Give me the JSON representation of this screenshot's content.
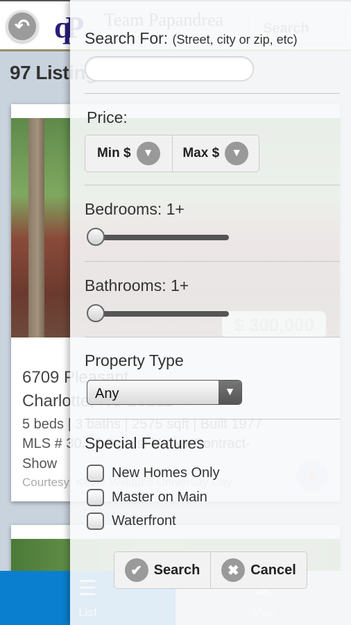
{
  "header": {
    "back_icon": "undo-arrow-icon",
    "logo_mark": "qP",
    "logo_text": "Team Papandrea",
    "search_label": "Search",
    "search_icon": "magnifier-icon"
  },
  "listing_count": "97 Listings",
  "listing": {
    "price": "$ 300,000",
    "address_line1": "6709 Pleasant",
    "address_line2": "Charlotte, NC 28211",
    "meta": "5 beds | 3 baths | 2575 sqft | Built 1977",
    "mls": "MLS # 30... | Status: Under Contract-",
    "status_cont": "Show",
    "courtesy": "Courtesy: Keller Williams University City",
    "favorite_icon": "heart-icon"
  },
  "tabs": [
    {
      "label": "List",
      "icon": "list-icon",
      "active": true
    },
    {
      "label": "Map",
      "icon": "map-icon",
      "active": false
    }
  ],
  "search_panel": {
    "search_for_label": "Search For:",
    "search_for_hint": "(Street, city or zip, etc)",
    "search_input_value": "",
    "search_input_placeholder": "",
    "price_label": "Price:",
    "min_price_label": "Min $",
    "max_price_label": "Max $",
    "bedrooms_label": "Bedrooms: 1+",
    "bedrooms_value": 1,
    "bathrooms_label": "Bathrooms: 1+",
    "bathrooms_value": 1,
    "property_type_label": "Property Type",
    "property_type_value": "Any",
    "special_features_label": "Special Features",
    "features": [
      {
        "label": "New Homes Only",
        "checked": false
      },
      {
        "label": "Master on Main",
        "checked": false
      },
      {
        "label": "Waterfront",
        "checked": false
      }
    ],
    "search_button": "Search",
    "cancel_button": "Cancel"
  },
  "colors": {
    "tab_active": "#0a7fcf",
    "logo": "#2a1d7a",
    "header_rule": "#9a8c6a"
  }
}
